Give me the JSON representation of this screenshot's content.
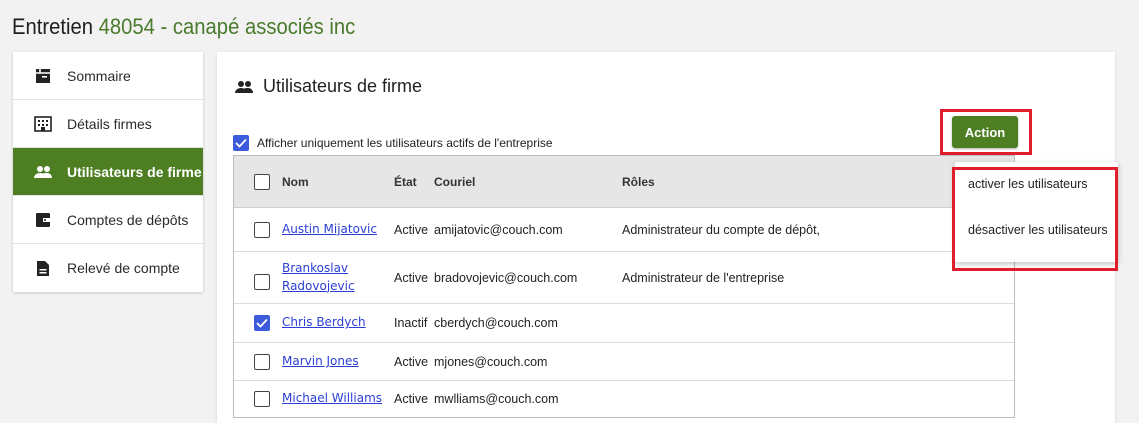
{
  "header": {
    "label": "Entretien",
    "sub": "48054 - canapé associés inc"
  },
  "sidebar": {
    "items": [
      {
        "label": "Sommaire",
        "icon": "summary-icon",
        "active": false
      },
      {
        "label": "Détails firmes",
        "icon": "building-icon",
        "active": false
      },
      {
        "label": "Utilisateurs de firme",
        "icon": "people-icon",
        "active": true
      },
      {
        "label": "Comptes de dépôts",
        "icon": "wallet-icon",
        "active": false
      },
      {
        "label": "Relevé de compte",
        "icon": "document-icon",
        "active": false
      }
    ]
  },
  "main": {
    "title": "Utilisateurs de firme",
    "filter_label": "Afficher uniquement les utilisateurs actifs de l'entreprise",
    "filter_checked": true,
    "action_label": "Action"
  },
  "table": {
    "headers": {
      "name": "Nom",
      "etat": "État",
      "mail": "Couriel",
      "roles": "Rôles"
    },
    "rows": [
      {
        "name": "Austin Mijatovic",
        "etat": "Active",
        "mail": "amijatovic@couch.com",
        "roles": "Administrateur du compte de dépôt,",
        "checked": false
      },
      {
        "name": "Brankoslav Radovojevic",
        "etat": "Active",
        "mail": "bradovojevic@couch.com",
        "roles": "Administrateur de l'entreprise",
        "checked": false
      },
      {
        "name": "Chris Berdych",
        "etat": "Inactif",
        "mail": "cberdych@couch.com",
        "roles": "",
        "checked": true
      },
      {
        "name": "Marvin Jones",
        "etat": "Active",
        "mail": "mjones@couch.com",
        "roles": "",
        "checked": false
      },
      {
        "name": "Michael Williams",
        "etat": "Active",
        "mail": "mwlliams@couch.com",
        "roles": "",
        "checked": false
      }
    ]
  },
  "dropdown": {
    "items": [
      "activer les utilisateurs",
      "désactiver les utilisateurs"
    ]
  },
  "colors": {
    "accent": "#4d7f22",
    "highlight": "#e01e2b",
    "checkbox": "#3b5bdb",
    "link": "#2b3fd6"
  }
}
